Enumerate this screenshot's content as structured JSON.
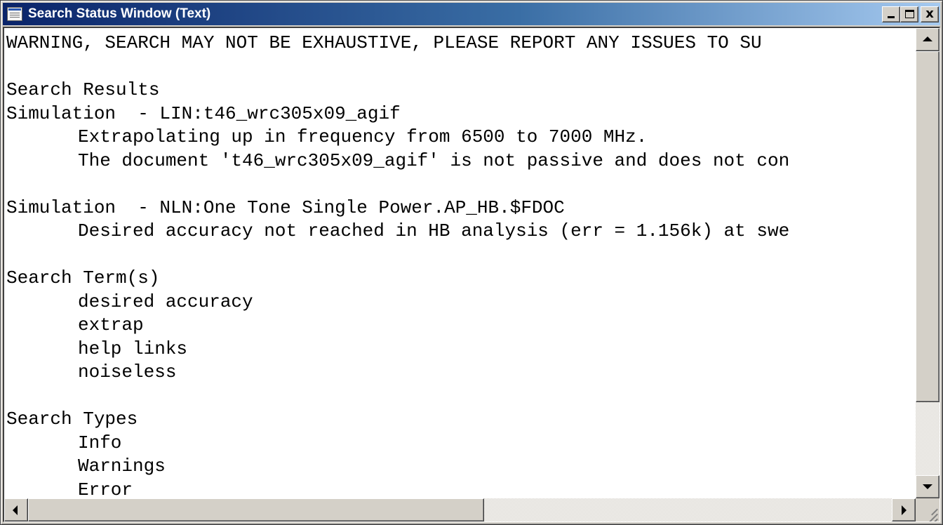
{
  "window": {
    "title": "Search Status Window (Text)",
    "close_glyph": "x"
  },
  "content": {
    "lines": [
      "WARNING, SEARCH MAY NOT BE EXHAUSTIVE, PLEASE REPORT ANY ISSUES TO SU",
      "",
      "Search Results",
      "Simulation  - LIN:t46_wrc305x09_agif",
      "Extrapolating up in frequency from 6500 to 7000 MHz.",
      "The document 't46_wrc305x09_agif' is not passive and does not con",
      "",
      "Simulation  - NLN:One Tone Single Power.AP_HB.$FDOC",
      "Desired accuracy not reached in HB analysis (err = 1.156k) at swe",
      "",
      "Search Term(s)",
      "desired accuracy",
      "extrap",
      "help links",
      "noiseless",
      "",
      "Search Types",
      "Info",
      "Warnings",
      "Error"
    ]
  },
  "icons": {
    "app": "text-window-icon",
    "minimize": "minimize-icon",
    "maximize": "maximize-icon",
    "close": "close-icon"
  }
}
